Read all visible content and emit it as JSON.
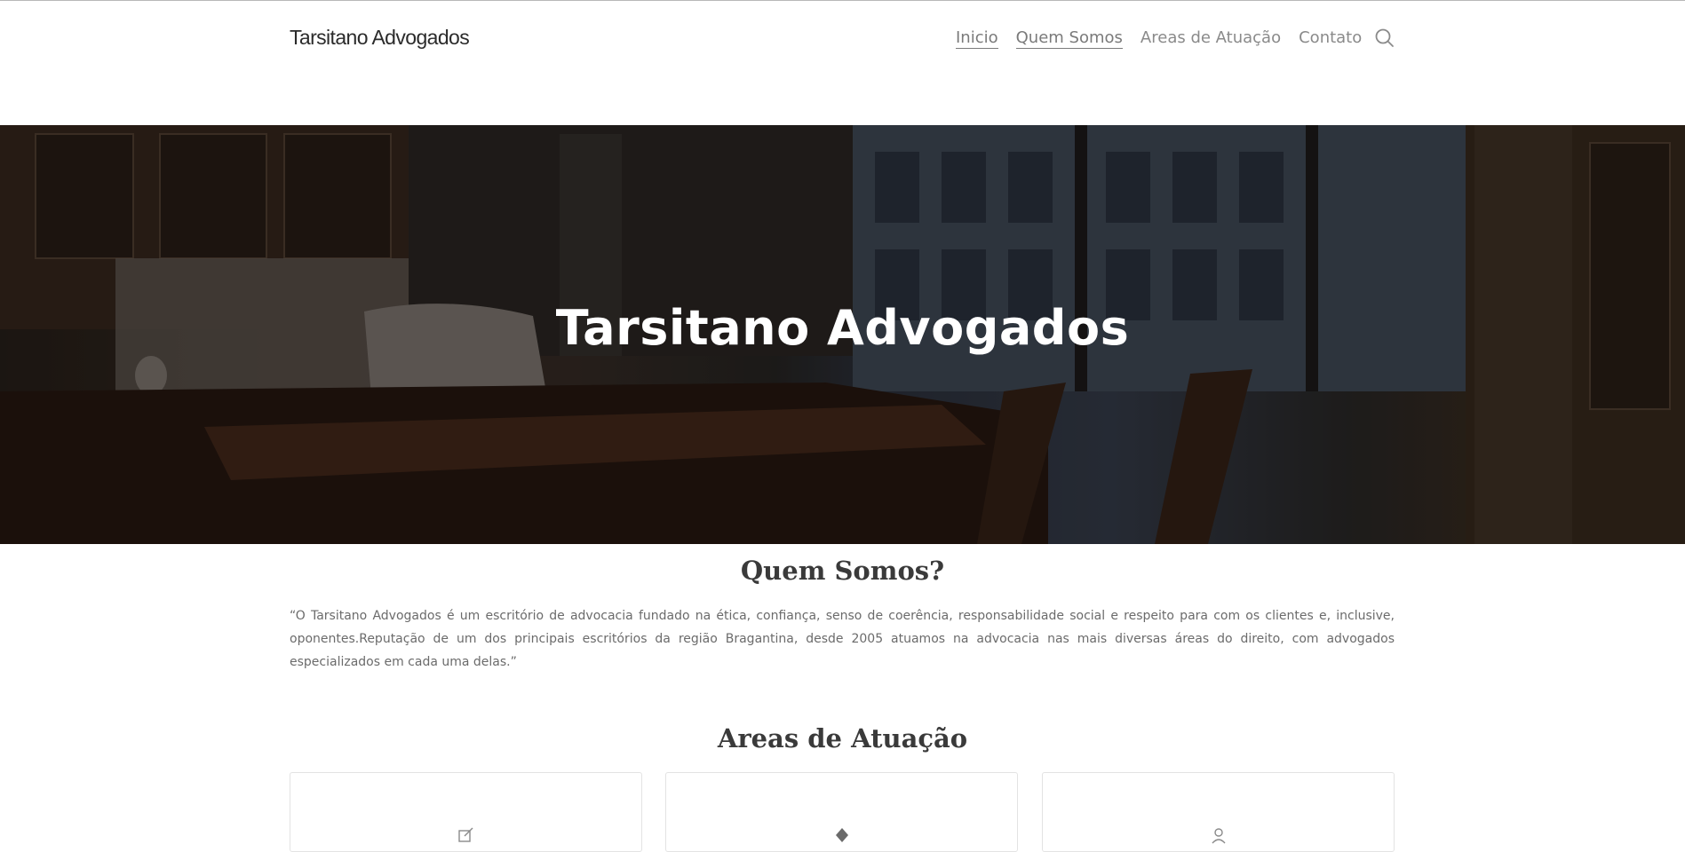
{
  "header": {
    "brand": "Tarsitano Advogados",
    "nav": [
      {
        "label": "Inicio"
      },
      {
        "label": "Quem Somos"
      },
      {
        "label": "Areas de Atuação"
      },
      {
        "label": "Contato"
      }
    ],
    "search_icon": "search-icon"
  },
  "hero": {
    "title": "Tarsitano Advogados"
  },
  "about": {
    "title": "Quem Somos?",
    "text": "“O Tarsitano Advogados é um escritório de advocacia fundado na ética, confiança, senso de coerência, responsabilidade social e respeito para com os clientes e, inclusive, oponentes.Reputação de um dos principais escritórios da região Bragantina, desde 2005 atuamos na advocacia nas mais diversas áreas do direito, com advogados especializados em cada uma delas.”"
  },
  "areas": {
    "title": "Areas de Atuação",
    "cards": [
      {
        "icon": "edit-icon"
      },
      {
        "icon": "diamond-icon"
      },
      {
        "icon": "user-icon"
      }
    ]
  }
}
